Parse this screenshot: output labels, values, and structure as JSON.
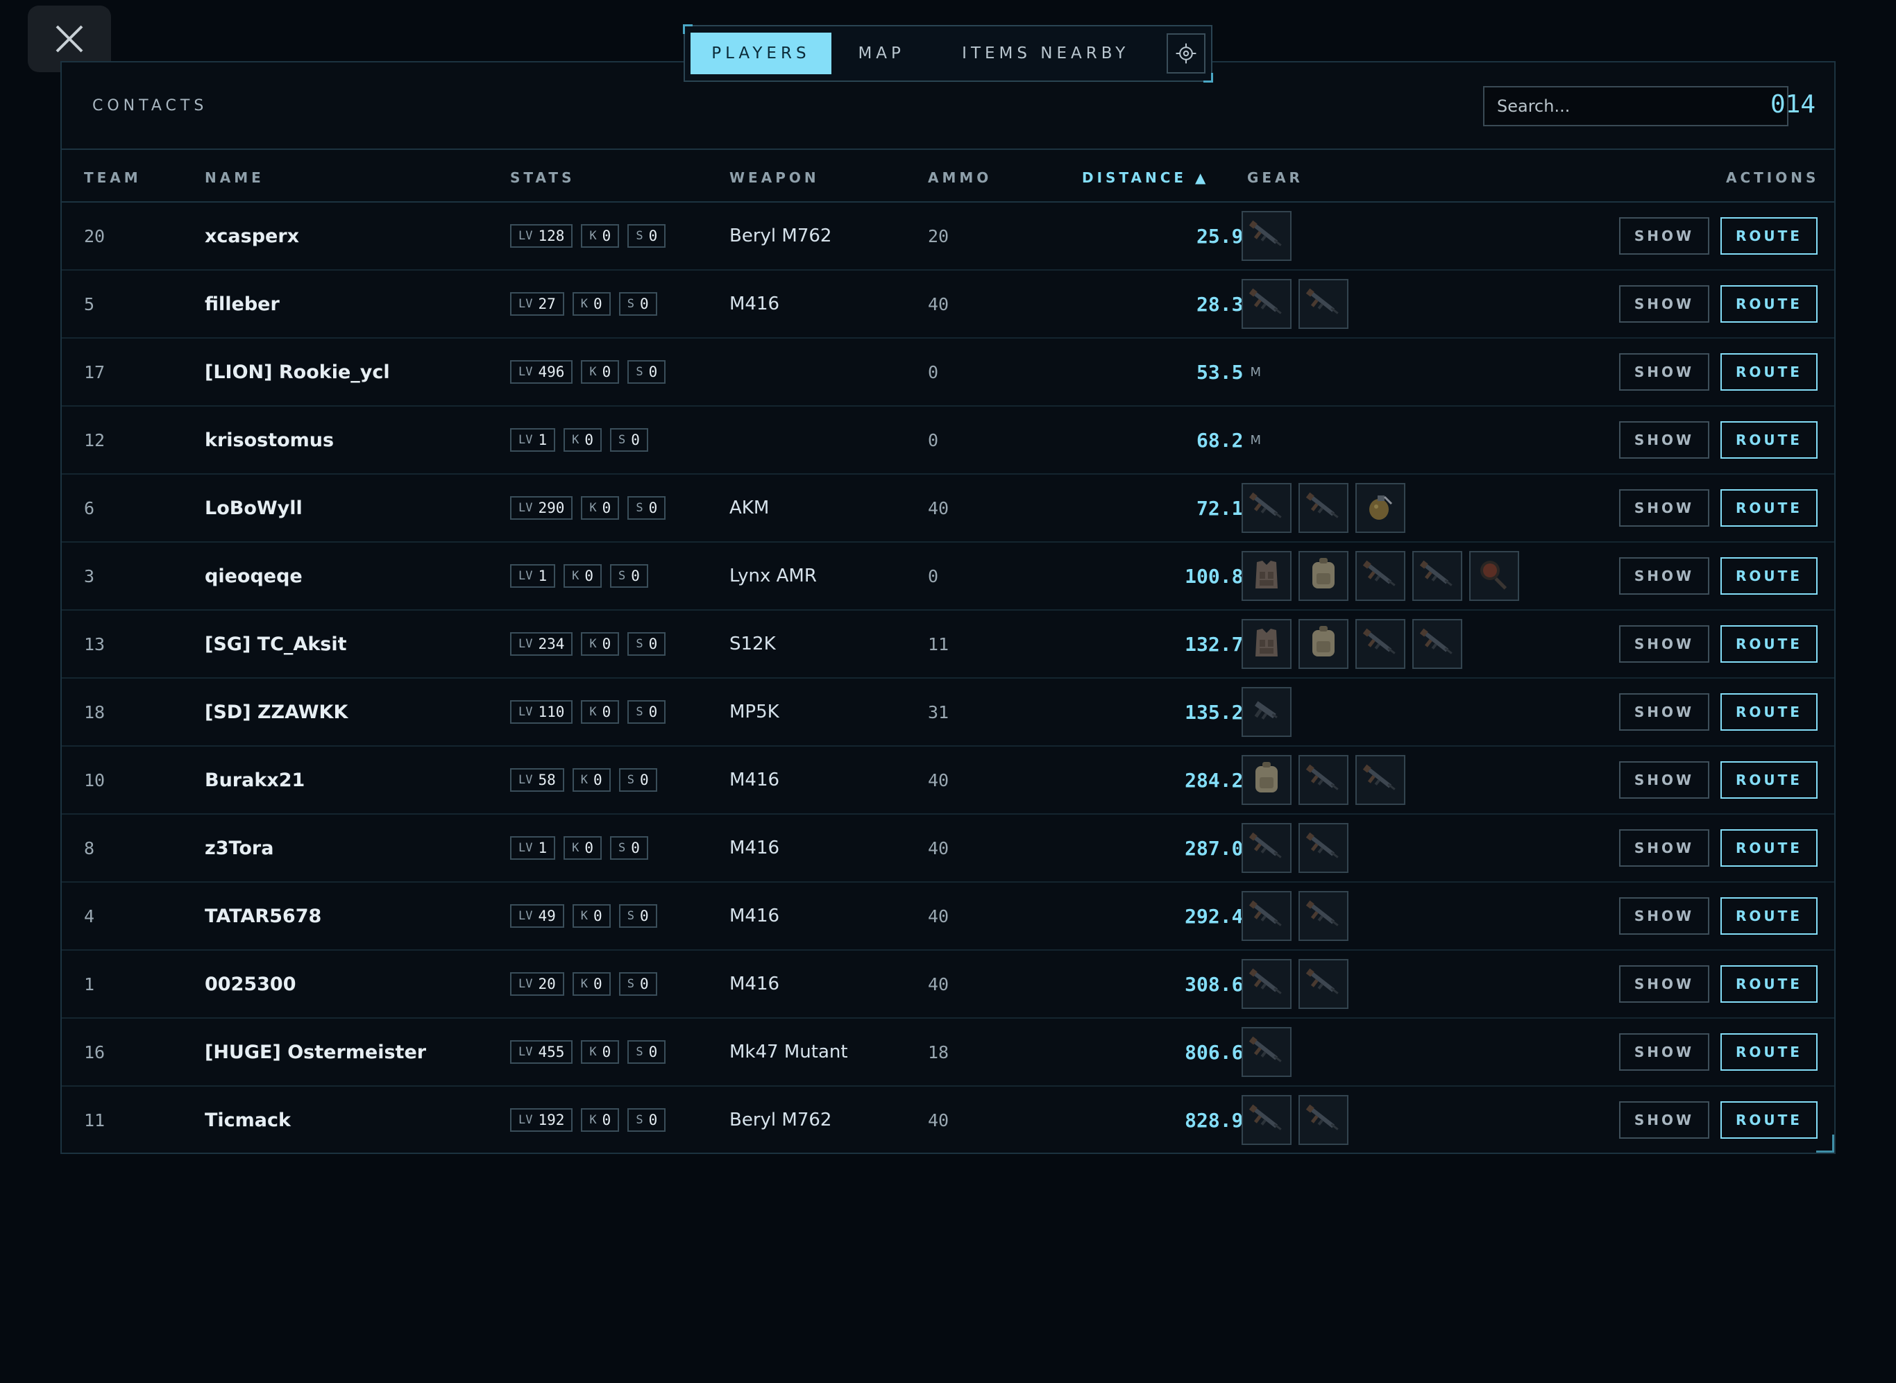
{
  "tabs": [
    "PLAYERS",
    "MAP",
    "ITEMS NEARBY"
  ],
  "panel": {
    "title": "CONTACTS",
    "search_placeholder": "Search...",
    "count": "014"
  },
  "columns": {
    "team": "TEAM",
    "name": "NAME",
    "stats": "STATS",
    "weapon": "WEAPON",
    "ammo": "AMMO",
    "distance": "DISTANCE ▲",
    "gear": "GEAR",
    "actions": "ACTIONS"
  },
  "labels": {
    "lv": "LV",
    "k": "K",
    "s": "S",
    "unit": "M",
    "show": "SHOW",
    "route": "ROUTE"
  },
  "colors": {
    "accent": "#84def8",
    "background": "#050a10"
  },
  "rows": [
    {
      "team": "20",
      "name": "xcasperx",
      "lv": "128",
      "k": "0",
      "s": "0",
      "weapon": "Beryl M762",
      "ammo": "20",
      "distance": "25.9",
      "gear": [
        "rifle-icon"
      ]
    },
    {
      "team": "5",
      "name": "filleber",
      "lv": "27",
      "k": "0",
      "s": "0",
      "weapon": "M416",
      "ammo": "40",
      "distance": "28.3",
      "gear": [
        "rifle-icon",
        "rifle-icon"
      ]
    },
    {
      "team": "17",
      "name": "[LION] Rookie_ycl",
      "lv": "496",
      "k": "0",
      "s": "0",
      "weapon": "",
      "ammo": "0",
      "distance": "53.5",
      "gear": []
    },
    {
      "team": "12",
      "name": "krisostomus",
      "lv": "1",
      "k": "0",
      "s": "0",
      "weapon": "",
      "ammo": "0",
      "distance": "68.2",
      "gear": []
    },
    {
      "team": "6",
      "name": "LoBoWyll",
      "lv": "290",
      "k": "0",
      "s": "0",
      "weapon": "AKM",
      "ammo": "40",
      "distance": "72.1",
      "gear": [
        "rifle-icon",
        "rifle-icon",
        "grenade-icon"
      ]
    },
    {
      "team": "3",
      "name": "qieoqeqe",
      "lv": "1",
      "k": "0",
      "s": "0",
      "weapon": "Lynx AMR",
      "ammo": "0",
      "distance": "100.8",
      "gear": [
        "vest-icon",
        "backpack-icon",
        "rifle-icon",
        "rifle-icon",
        "pan-icon"
      ]
    },
    {
      "team": "13",
      "name": "[SG] TC_Aksit",
      "lv": "234",
      "k": "0",
      "s": "0",
      "weapon": "S12K",
      "ammo": "11",
      "distance": "132.7",
      "gear": [
        "vest-icon",
        "backpack-icon",
        "rifle-icon",
        "rifle-icon"
      ]
    },
    {
      "team": "18",
      "name": "[SD] ZZAWKK",
      "lv": "110",
      "k": "0",
      "s": "0",
      "weapon": "MP5K",
      "ammo": "31",
      "distance": "135.2",
      "gear": [
        "smg-icon"
      ]
    },
    {
      "team": "10",
      "name": "Burakx21",
      "lv": "58",
      "k": "0",
      "s": "0",
      "weapon": "M416",
      "ammo": "40",
      "distance": "284.2",
      "gear": [
        "backpack-icon",
        "rifle-icon",
        "rifle-icon"
      ]
    },
    {
      "team": "8",
      "name": "z3Tora",
      "lv": "1",
      "k": "0",
      "s": "0",
      "weapon": "M416",
      "ammo": "40",
      "distance": "287.0",
      "gear": [
        "rifle-icon",
        "rifle-icon"
      ]
    },
    {
      "team": "4",
      "name": "TATAR5678",
      "lv": "49",
      "k": "0",
      "s": "0",
      "weapon": "M416",
      "ammo": "40",
      "distance": "292.4",
      "gear": [
        "rifle-icon",
        "rifle-icon"
      ]
    },
    {
      "team": "1",
      "name": "0025300",
      "lv": "20",
      "k": "0",
      "s": "0",
      "weapon": "M416",
      "ammo": "40",
      "distance": "308.6",
      "gear": [
        "rifle-icon",
        "rifle-icon"
      ]
    },
    {
      "team": "16",
      "name": "[HUGE] Ostermeister",
      "lv": "455",
      "k": "0",
      "s": "0",
      "weapon": "Mk47 Mutant",
      "ammo": "18",
      "distance": "806.6",
      "gear": [
        "rifle-icon"
      ]
    },
    {
      "team": "11",
      "name": "Ticmack",
      "lv": "192",
      "k": "0",
      "s": "0",
      "weapon": "Beryl M762",
      "ammo": "40",
      "distance": "828.9",
      "gear": [
        "rifle-icon",
        "rifle-icon"
      ]
    }
  ]
}
